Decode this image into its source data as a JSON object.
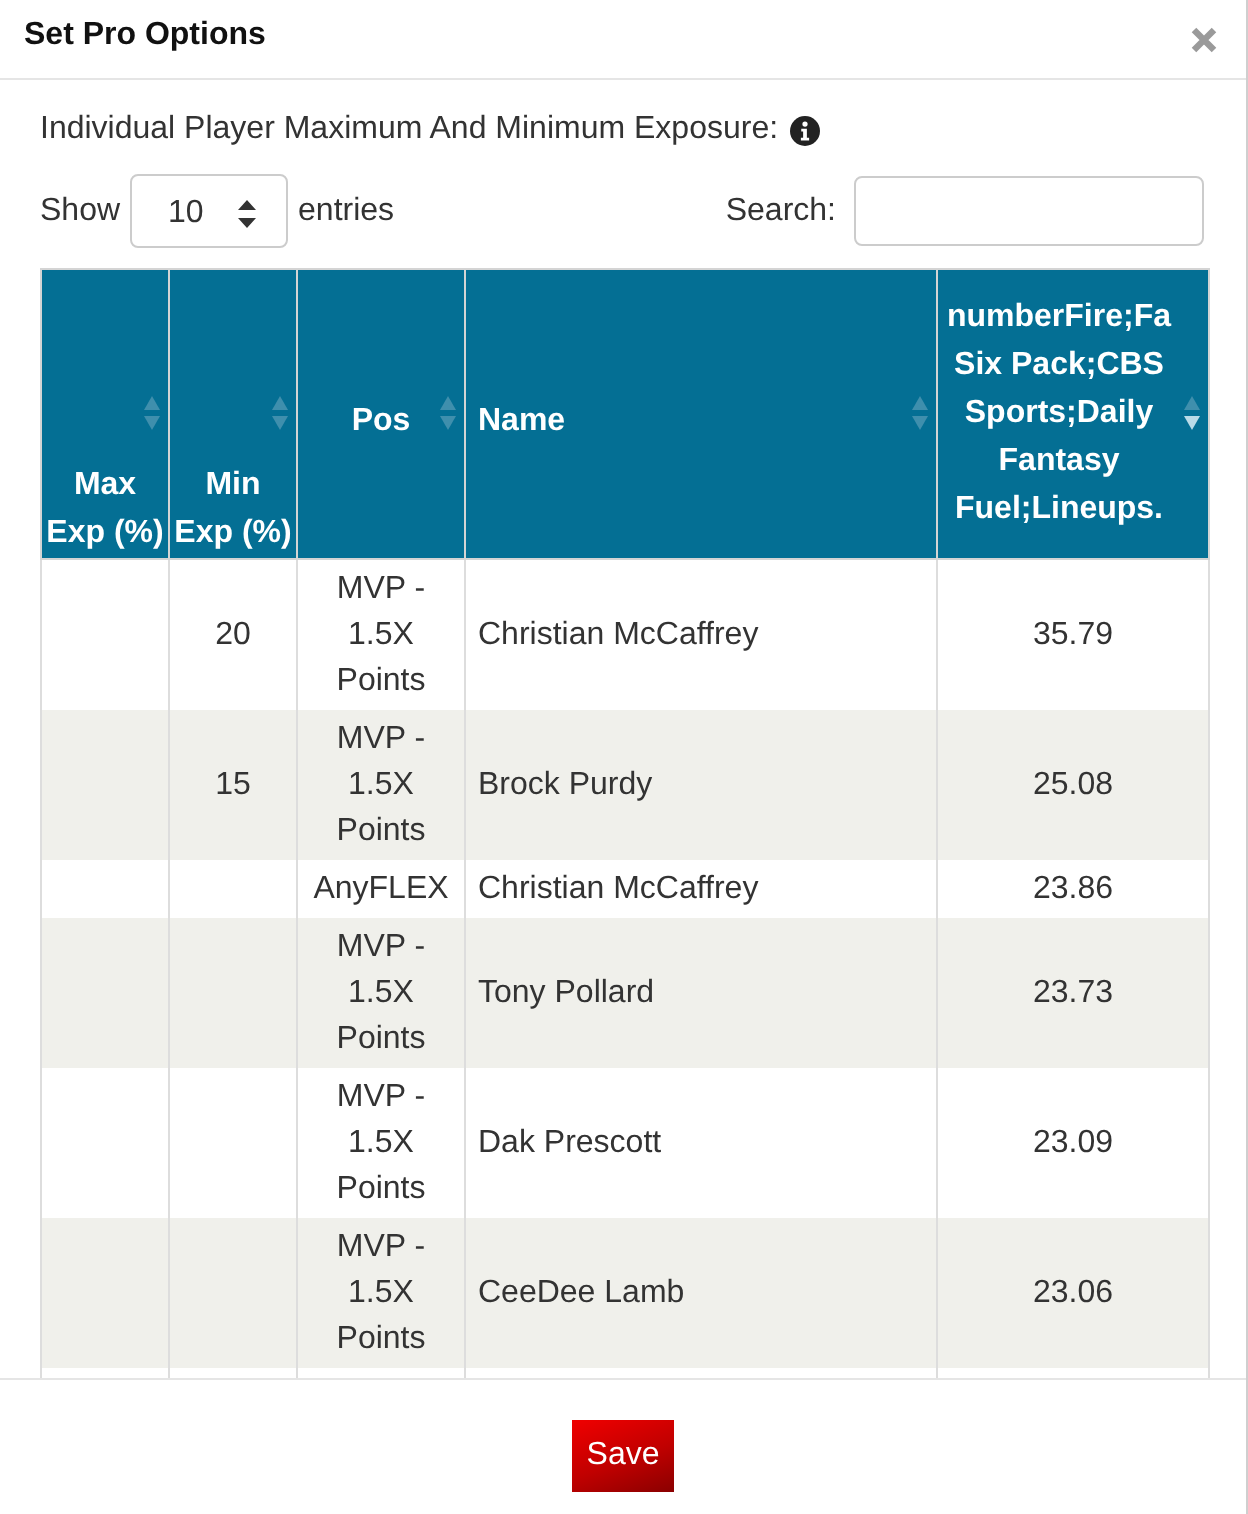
{
  "modal": {
    "title": "Set Pro Options"
  },
  "intro": {
    "text": "Individual Player Maximum And Minimum Exposure:"
  },
  "length_menu": {
    "label": "Show",
    "value": "10",
    "suffix": "entries"
  },
  "search": {
    "label": "Search:"
  },
  "table": {
    "columns": [
      {
        "label": "Max Exp (%)",
        "sorted_descending": false
      },
      {
        "label": "Min Exp (%)",
        "sorted_descending": false
      },
      {
        "label": "Pos",
        "sorted_descending": false
      },
      {
        "label": "Name",
        "sorted_descending": false
      },
      {
        "label": "numberFire;Fa Six Pack;CBS Sports;Daily Fantasy Fuel;Lineups.",
        "sorted_descending": true
      }
    ],
    "rows": [
      {
        "min_exp": "20",
        "pos": "MVP - 1.5X Points",
        "name": "Christian McCaffrey",
        "column_5": "35.79"
      },
      {
        "min_exp": "15",
        "pos": "MVP - 1.5X Points",
        "name": "Brock Purdy",
        "column_5": "25.08"
      },
      {
        "pos": "AnyFLEX",
        "name": "Christian McCaffrey",
        "column_5": "23.86"
      },
      {
        "pos": "MVP - 1.5X Points",
        "name": "Tony Pollard",
        "column_5": "23.73"
      },
      {
        "pos": "MVP - 1.5X Points",
        "name": "Dak Prescott",
        "column_5": "23.09"
      },
      {
        "pos": "MVP - 1.5X Points",
        "name": "CeeDee Lamb",
        "column_5": "23.06"
      }
    ]
  },
  "footer": {
    "save": "Save"
  }
}
